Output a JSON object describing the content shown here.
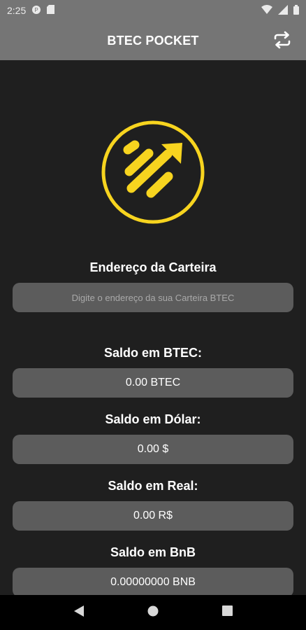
{
  "status_bar": {
    "time": "2:25"
  },
  "app_bar": {
    "title": "BTEC POCKET"
  },
  "wallet": {
    "label": "Endereço da Carteira",
    "placeholder": "Digite o endereço da sua Carteira BTEC"
  },
  "balances": [
    {
      "label": "Saldo em BTEC:",
      "value": "0.00 BTEC"
    },
    {
      "label": "Saldo em Dólar:",
      "value": "0.00 $"
    },
    {
      "label": "Saldo em Real:",
      "value": "0.00 R$"
    },
    {
      "label": "Saldo em BnB",
      "value": "0.00000000 BNB"
    }
  ],
  "colors": {
    "accent": "#f7d41f",
    "bar": "#757575",
    "background": "#1f1f1f",
    "field": "#5c5c5c"
  }
}
